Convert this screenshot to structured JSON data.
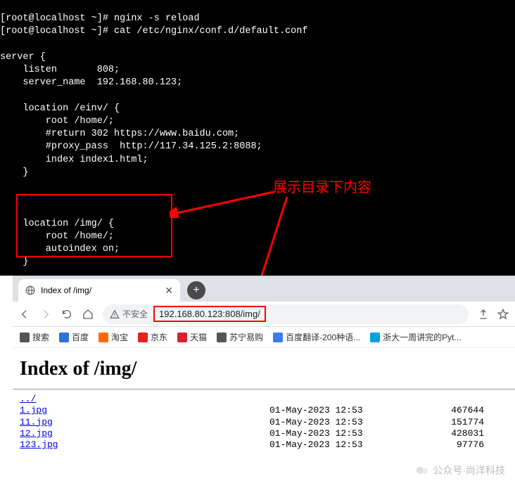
{
  "terminal": {
    "prompt_line0": "[root@localhost ~]# nginx -s reload",
    "prompt_line1": "[root@localhost ~]# cat /etc/nginx/conf.d/default.conf",
    "conf": "\nserver {\n    listen       808;\n    server_name  192.168.80.123;\n\n    location /einv/ {\n        root /home/;\n        #return 302 https://www.baidu.com;\n        #proxy_pass  http://117.34.125.2:8088;\n        index index1.html;\n    }\n\n\n\n    location /img/ {\n        root /home/;\n        autoindex on;\n    }"
  },
  "annotation": {
    "label": "展示目录下内容"
  },
  "browser": {
    "tab_title": "Index of /img/",
    "insecure_label": "不安全",
    "url": "192.168.80.123:808/img/",
    "bookmarks": [
      {
        "label": "搜索",
        "color": "#555"
      },
      {
        "label": "百度",
        "color": "#2b72d9"
      },
      {
        "label": "淘宝",
        "color": "#ff6a00"
      },
      {
        "label": "京东",
        "color": "#e1251b"
      },
      {
        "label": "天猫",
        "color": "#d91f2a"
      },
      {
        "label": "苏宁易购",
        "color": "#555"
      },
      {
        "label": "百度翻译-200种语...",
        "color": "#3a7af2"
      },
      {
        "label": "浙大一周讲完的Pyt...",
        "color": "#00a2e1"
      }
    ]
  },
  "page": {
    "heading": "Index of /img/",
    "parent": "../",
    "files": [
      {
        "name": "1.jpg",
        "date": "01-May-2023 12:53",
        "size": "467644"
      },
      {
        "name": "11.jpg",
        "date": "01-May-2023 12:53",
        "size": "151774"
      },
      {
        "name": "12.jpg",
        "date": "01-May-2023 12:53",
        "size": "428031"
      },
      {
        "name": "123.jpg",
        "date": "01-May-2023 12:53",
        "size": "97776"
      }
    ]
  },
  "watermark": {
    "text": "公众号·尚洋科技"
  }
}
